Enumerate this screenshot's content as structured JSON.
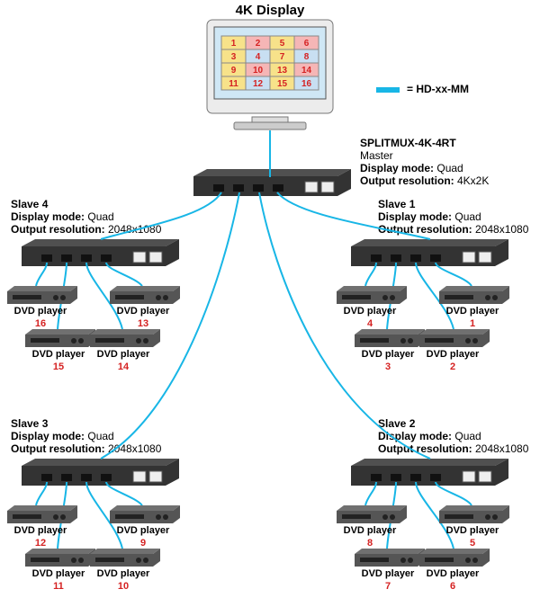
{
  "title": "4K Display",
  "legend": {
    "swatch_color": "#18b6e6",
    "label": "= HD-xx-MM"
  },
  "display_grid": {
    "cells": [
      {
        "n": "1",
        "bg": "#f7e28a"
      },
      {
        "n": "2",
        "bg": "#f5b6b6"
      },
      {
        "n": "5",
        "bg": "#f7e28a"
      },
      {
        "n": "6",
        "bg": "#f5b6b6"
      },
      {
        "n": "3",
        "bg": "#f7e28a"
      },
      {
        "n": "4",
        "bg": "#c8dff2"
      },
      {
        "n": "7",
        "bg": "#f7e28a"
      },
      {
        "n": "8",
        "bg": "#c8dff2"
      },
      {
        "n": "9",
        "bg": "#f7e28a"
      },
      {
        "n": "10",
        "bg": "#f5b6b6"
      },
      {
        "n": "13",
        "bg": "#f7e28a"
      },
      {
        "n": "14",
        "bg": "#f5b6b6"
      },
      {
        "n": "11",
        "bg": "#f7e28a"
      },
      {
        "n": "12",
        "bg": "#c8dff2"
      },
      {
        "n": "15",
        "bg": "#f7e28a"
      },
      {
        "n": "16",
        "bg": "#c8dff2"
      }
    ]
  },
  "master": {
    "name": "SPLITMUX-4K-4RT",
    "role": "Master",
    "mode_label": "Display mode:",
    "mode_value": "Quad",
    "res_label": "Output resolution:",
    "res_value": "4Kx2K"
  },
  "slaves": {
    "s1": {
      "name": "Slave 1",
      "mode_label": "Display mode:",
      "mode_value": "Quad",
      "res_label": "Output resolution:",
      "res_value": "2048x1080"
    },
    "s2": {
      "name": "Slave 2",
      "mode_label": "Display mode:",
      "mode_value": "Quad",
      "res_label": "Output resolution:",
      "res_value": "2048x1080"
    },
    "s3": {
      "name": "Slave 3",
      "mode_label": "Display mode:",
      "mode_value": "Quad",
      "res_label": "Output resolution:",
      "res_value": "2048x1080"
    },
    "s4": {
      "name": "Slave 4",
      "mode_label": "Display mode:",
      "mode_value": "Quad",
      "res_label": "Output resolution:",
      "res_value": "2048x1080"
    }
  },
  "dvd_label": "DVD player",
  "groups": {
    "s4": {
      "top_left": "16",
      "top_right": "13",
      "bot_left": "15",
      "bot_right": "14"
    },
    "s1": {
      "top_left": "4",
      "top_right": "1",
      "bot_left": "3",
      "bot_right": "2"
    },
    "s3": {
      "top_left": "12",
      "top_right": "9",
      "bot_left": "11",
      "bot_right": "10"
    },
    "s2": {
      "top_left": "8",
      "top_right": "5",
      "bot_left": "7",
      "bot_right": "6"
    }
  }
}
